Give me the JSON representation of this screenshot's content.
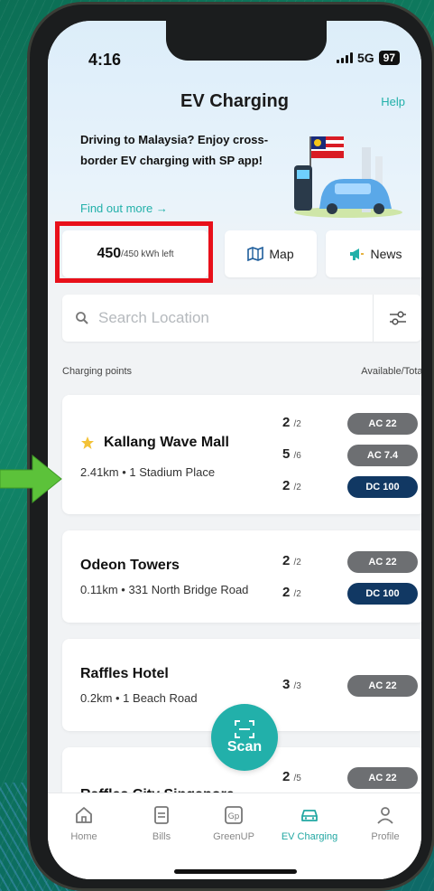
{
  "status_bar": {
    "time": "4:16",
    "network": "5G",
    "battery": "97"
  },
  "header": {
    "title": "EV Charging",
    "help": "Help",
    "promo_text": "Driving to Malaysia? Enjoy cross-border EV charging with SP app!",
    "find_more": "Find out more →"
  },
  "quick_tiles": {
    "kwh_value": "450",
    "kwh_rest": "/450 kWh left",
    "map_label": "Map",
    "news_label": "News"
  },
  "search": {
    "placeholder": "Search Location",
    "value": ""
  },
  "list_header": {
    "left": "Charging points",
    "right": "Available/Total"
  },
  "stations": [
    {
      "name": "Kallang Wave Mall",
      "starred": true,
      "distance_address": "2.41km • 1 Stadium Place",
      "chargers": [
        {
          "available": "2",
          "total": "/2",
          "type": "AC 22"
        },
        {
          "available": "5",
          "total": "/6",
          "type": "AC 7.4"
        },
        {
          "available": "2",
          "total": "/2",
          "type": "DC 100"
        }
      ]
    },
    {
      "name": "Odeon Towers",
      "starred": false,
      "distance_address": "0.11km • 331 North Bridge Road",
      "chargers": [
        {
          "available": "2",
          "total": "/2",
          "type": "AC 22"
        },
        {
          "available": "2",
          "total": "/2",
          "type": "DC 100"
        }
      ]
    },
    {
      "name": "Raffles Hotel",
      "starred": false,
      "distance_address": "0.2km • 1 Beach Road",
      "chargers": [
        {
          "available": "3",
          "total": "/3",
          "type": "AC 22"
        }
      ]
    },
    {
      "name": "Raffles City Singapore",
      "starred": false,
      "distance_address": "",
      "chargers": [
        {
          "available": "2",
          "total": "/5",
          "type": "AC 22"
        }
      ]
    }
  ],
  "scan_button": {
    "label": "Scan"
  },
  "tabs": [
    {
      "label": "Home",
      "icon": "home-icon"
    },
    {
      "label": "Bills",
      "icon": "bills-icon"
    },
    {
      "label": "GreenUP",
      "icon": "greenup-icon"
    },
    {
      "label": "EV Charging",
      "icon": "car-icon",
      "active": true
    },
    {
      "label": "Profile",
      "icon": "profile-icon"
    }
  ],
  "colors": {
    "accent": "#21b0a9",
    "dc_badge": "#113863",
    "ac_badge": "#6d6f72",
    "highlight": "#e8101a",
    "arrow": "#5cc23a"
  }
}
